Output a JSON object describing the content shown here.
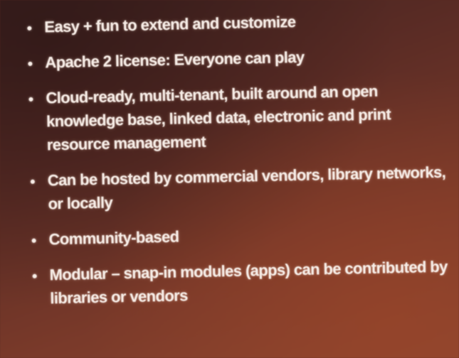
{
  "slide": {
    "bullets": [
      {
        "text": "Easy + fun to extend and customize"
      },
      {
        "text": "Apache 2 license: Everyone can play"
      },
      {
        "text": "Cloud-ready, multi-tenant, built around an open knowledge base, linked data, electronic and print resource management"
      },
      {
        "text": "Can be hosted by commercial vendors, library networks, or locally"
      },
      {
        "text": "Community-based"
      },
      {
        "text": "Modular – snap-in modules (apps) can be contributed by libraries or vendors"
      }
    ]
  },
  "colors": {
    "background": "#5b2c25",
    "text": "#f6ece6"
  }
}
